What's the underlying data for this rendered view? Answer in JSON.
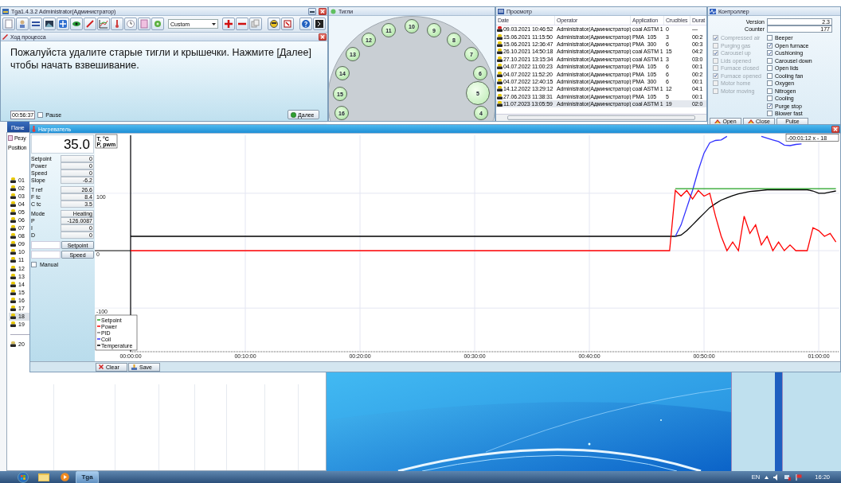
{
  "main_window": {
    "title": "Tga1.4.3.2 Administrator(Администратор)",
    "profile": "Custom",
    "process": {
      "title": "Ход процесса",
      "message": "Пожалуйста удалите старые тигли и крышечки. Нажмите [Далее] чтобы начать взвешивание.",
      "timer": "00:56:37",
      "pause": {
        "label": "Pause",
        "checked": false
      },
      "next_button": "Далее"
    }
  },
  "crucibles_window": {
    "title": "Тигли",
    "positions": [
      {
        "label": "4",
        "selected": false
      },
      {
        "label": "5",
        "selected": true
      },
      {
        "label": "6",
        "selected": false
      },
      {
        "label": "7",
        "selected": false
      },
      {
        "label": "8",
        "selected": false
      },
      {
        "label": "9",
        "selected": false
      },
      {
        "label": "10",
        "selected": false
      },
      {
        "label": "11",
        "selected": false
      },
      {
        "label": "12",
        "selected": false
      },
      {
        "label": "13",
        "selected": false
      },
      {
        "label": "14",
        "selected": false
      },
      {
        "label": "15",
        "selected": false
      },
      {
        "label": "16",
        "selected": false
      }
    ]
  },
  "history_window": {
    "title": "Просмотр",
    "columns": [
      "Date",
      "Operator",
      "Application",
      "Crucibles",
      "Durat"
    ],
    "rows": [
      {
        "color": "#d82020",
        "selected": false,
        "cells": [
          "09.03.2021 10:46:52",
          "Administrator(Администратор)",
          "coal ASTM 1",
          "0",
          "—"
        ]
      },
      {
        "color": "#e8c800",
        "selected": false,
        "cells": [
          "15.06.2021 11:15:50",
          "Administrator(Администратор)",
          "PMA_105",
          "3",
          "00:2"
        ]
      },
      {
        "color": "#e8c800",
        "selected": false,
        "cells": [
          "15.06.2021 12:36:47",
          "Administrator(Администратор)",
          "PMA_300",
          "6",
          "00:3"
        ]
      },
      {
        "color": "#e8c800",
        "selected": false,
        "cells": [
          "26.10.2021 14:50:18",
          "Administrator(Администратор)",
          "coal ASTM 1",
          "15",
          "04:2"
        ]
      },
      {
        "color": "#e8c800",
        "selected": false,
        "cells": [
          "27.10.2021 13:15:34",
          "Administrator(Администратор)",
          "coal ASTM 1",
          "3",
          "03:0"
        ]
      },
      {
        "color": "#e8c800",
        "selected": false,
        "cells": [
          "04.07.2022 11:00:23",
          "Administrator(Администратор)",
          "PMA_105",
          "6",
          "00:1"
        ]
      },
      {
        "color": "#e8c800",
        "selected": false,
        "cells": [
          "04.07.2022 11:52:20",
          "Administrator(Администратор)",
          "PMA_105",
          "6",
          "00:2"
        ]
      },
      {
        "color": "#e8c800",
        "selected": false,
        "cells": [
          "04.07.2022 12:40:15",
          "Administrator(Администратор)",
          "PMA_300",
          "6",
          "00:1"
        ]
      },
      {
        "color": "#e8c800",
        "selected": false,
        "cells": [
          "14.12.2022 13:29:12",
          "Administrator(Администратор)",
          "coal ASTM 1",
          "12",
          "04:1"
        ]
      },
      {
        "color": "#e8c800",
        "selected": false,
        "cells": [
          "27.06.2023 11:38:31",
          "Administrator(Администратор)",
          "PMA_105",
          "5",
          "00:1"
        ]
      },
      {
        "color": "#e8c800",
        "selected": true,
        "cells": [
          "11.07.2023 13:05:59",
          "Administrator(Администратор)",
          "coal ASTM 1",
          "19",
          "02:0"
        ]
      }
    ]
  },
  "controller_window": {
    "title": "Контроллер",
    "fields": [
      {
        "label": "Version",
        "value": "2.3"
      },
      {
        "label": "Counter",
        "value": "177"
      }
    ],
    "inputs": [
      {
        "label": "Compressed air",
        "checked": true,
        "disabled": true
      },
      {
        "label": "Purging gas",
        "checked": false,
        "disabled": true
      },
      {
        "label": "Carousel up",
        "checked": true,
        "disabled": true
      },
      {
        "label": "Lids opened",
        "checked": false,
        "disabled": true
      },
      {
        "label": "Furnace closed",
        "checked": false,
        "disabled": true
      },
      {
        "label": "Furnace opened",
        "checked": true,
        "disabled": true
      },
      {
        "label": "Motor home",
        "checked": false,
        "disabled": true
      },
      {
        "label": "Motor moving",
        "checked": false,
        "disabled": true
      }
    ],
    "outputs": [
      {
        "label": "Beeper",
        "checked": false,
        "disabled": false
      },
      {
        "label": "Open furnace",
        "checked": true,
        "disabled": false
      },
      {
        "label": "Cushioning",
        "checked": true,
        "disabled": false
      },
      {
        "label": "Carousel down",
        "checked": false,
        "disabled": false
      },
      {
        "label": "Open lids",
        "checked": false,
        "disabled": false
      },
      {
        "label": "Cooling fan",
        "checked": false,
        "disabled": false
      },
      {
        "label": "Oxygen",
        "checked": false,
        "disabled": false
      },
      {
        "label": "Nitrogen",
        "checked": false,
        "disabled": false
      },
      {
        "label": "Cooling",
        "checked": false,
        "disabled": false
      },
      {
        "label": "Purge stop",
        "checked": true,
        "disabled": false
      },
      {
        "label": "Blower fast",
        "checked": false,
        "disabled": false
      }
    ],
    "buttons": [
      {
        "label": "Open",
        "kind": "lid"
      },
      {
        "label": "Close",
        "kind": "lid"
      },
      {
        "label": "Pulse",
        "kind": "plain"
      }
    ]
  },
  "results_panel": {
    "panel_tab": "Пане",
    "title": "Резу",
    "column": "Position",
    "positions": [
      {
        "label": "01",
        "selected": false,
        "color": "#e8c800"
      },
      {
        "label": "02",
        "selected": false,
        "color": "#e8c800"
      },
      {
        "label": "03",
        "selected": false,
        "color": "#e8c800"
      },
      {
        "label": "04",
        "selected": false,
        "color": "#e8c800"
      },
      {
        "label": "05",
        "selected": false,
        "color": "#e8c800"
      },
      {
        "label": "06",
        "selected": false,
        "color": "#e8c800"
      },
      {
        "label": "07",
        "selected": false,
        "color": "#e8c800"
      },
      {
        "label": "08",
        "selected": false,
        "color": "#e8c800"
      },
      {
        "label": "09",
        "selected": false,
        "color": "#e8c800"
      },
      {
        "label": "10",
        "selected": false,
        "color": "#e8c800"
      },
      {
        "label": "11",
        "selected": false,
        "color": "#e8c800"
      },
      {
        "label": "12",
        "selected": false,
        "color": "#e8c800"
      },
      {
        "label": "13",
        "selected": false,
        "color": "#e8c800"
      },
      {
        "label": "14",
        "selected": false,
        "color": "#e8c800"
      },
      {
        "label": "15",
        "selected": false,
        "color": "#e8c800"
      },
      {
        "label": "16",
        "selected": false,
        "color": "#e8c800"
      },
      {
        "label": "17",
        "selected": false,
        "color": "#e8c800"
      },
      {
        "label": "18",
        "selected": true,
        "color": "#e8c800"
      },
      {
        "label": "19",
        "selected": false,
        "color": "#e8c800"
      }
    ],
    "extra_position": {
      "label": "20",
      "selected": false,
      "color": "#d8c060"
    }
  },
  "heater_window": {
    "title": "Нагреватель",
    "temperature": "35.0",
    "reading_groups": [
      [
        {
          "label": "Setpoint",
          "value": "0"
        },
        {
          "label": "Power",
          "value": "0"
        },
        {
          "label": "Speed",
          "value": "0"
        },
        {
          "label": "Slope",
          "value": "-6.2"
        }
      ],
      [
        {
          "label": "T ref",
          "value": "26.6"
        },
        {
          "label": "F tc",
          "value": "8.4"
        },
        {
          "label": "C tc",
          "value": "3.5"
        }
      ],
      [
        {
          "label": "Mode",
          "value": "Heating"
        },
        {
          "label": "P",
          "value": "-126.0087"
        },
        {
          "label": "I",
          "value": "0"
        },
        {
          "label": "D",
          "value": "0"
        }
      ]
    ],
    "controls": [
      "Setpoint",
      "Speed"
    ],
    "manual": {
      "label": "Manual",
      "checked": false
    },
    "chart_data": {
      "type": "line",
      "ylabel": "T, °C P, pwm",
      "legend": "lower left",
      "grid": true,
      "x": [
        0,
        10,
        20,
        30,
        40,
        47,
        47.5,
        48,
        48.5,
        49,
        49.5,
        50,
        50.5,
        51,
        51.5,
        52,
        52.5,
        53,
        53.5,
        54,
        54.5,
        55,
        55.5,
        56,
        56.5,
        57,
        57.5,
        58,
        58.5,
        59,
        59.5,
        60,
        60.5,
        61,
        61.5
      ],
      "xlim": [
        0,
        61.8
      ],
      "ylim": [
        -176,
        201
      ],
      "xticks": [
        {
          "value": 0,
          "label": "00:00:00"
        },
        {
          "value": 10,
          "label": "00:10:00"
        },
        {
          "value": 20,
          "label": "00:20:00"
        },
        {
          "value": 30,
          "label": "00:30:00"
        },
        {
          "value": 40,
          "label": "00:40:00"
        },
        {
          "value": 50,
          "label": "00:50:00"
        },
        {
          "value": 60,
          "label": "01:00:00"
        }
      ],
      "yticks": [
        100,
        0,
        -100
      ],
      "series": [
        {
          "name": "Setpoint",
          "color": "#20a020",
          "values": [
            null,
            null,
            null,
            null,
            null,
            null,
            108,
            108,
            108,
            108,
            108,
            108,
            108,
            108,
            108,
            108,
            108,
            108,
            108,
            108,
            108,
            108,
            108,
            108,
            108,
            108,
            108,
            108,
            108,
            108,
            108,
            108,
            108,
            108,
            108
          ]
        },
        {
          "name": "Power",
          "color": "#ff0000",
          "values": [
            0,
            0,
            0,
            0,
            0,
            0,
            105,
            95,
            105,
            90,
            105,
            95,
            100,
            60,
            25,
            0,
            15,
            0,
            60,
            30,
            45,
            10,
            25,
            0,
            15,
            0,
            10,
            0,
            0,
            0,
            40,
            35,
            25,
            30,
            15
          ]
        },
        {
          "name": "PID",
          "color": "#808080",
          "values": [
            null,
            null,
            null,
            null,
            null,
            null,
            null,
            null,
            null,
            null,
            null,
            null,
            null,
            null,
            null,
            null,
            null,
            null,
            null,
            null,
            null,
            null,
            null,
            null,
            null,
            null,
            null,
            null,
            null,
            null,
            null,
            null,
            null,
            null,
            null
          ]
        },
        {
          "name": "Coil",
          "color": "#3030ff",
          "values": [
            null,
            null,
            null,
            null,
            null,
            null,
            25,
            45,
            75,
            105,
            140,
            170,
            188,
            192,
            193,
            199,
            null,
            null,
            null,
            null,
            null,
            199,
            196,
            193,
            190,
            184,
            183,
            185,
            186,
            null,
            null,
            null,
            null,
            null,
            null
          ]
        },
        {
          "name": "Temperature",
          "color": "#000000",
          "values": [
            25,
            25,
            25,
            25,
            25,
            25,
            25,
            27,
            35,
            45,
            55,
            65,
            75,
            82,
            88,
            92,
            96,
            99,
            101,
            103,
            104,
            105,
            106,
            106,
            106,
            106,
            106,
            106,
            106,
            106,
            104,
            100,
            100,
            102,
            104
          ]
        }
      ],
      "annotations": [
        "-00:01:12 x - 18"
      ]
    },
    "actions": [
      {
        "label": "Clear",
        "kind": "clear"
      },
      {
        "label": "Save",
        "kind": "save"
      }
    ]
  },
  "taskbar": {
    "app_button": "Tga",
    "language": "EN",
    "clock": "16:20"
  }
}
